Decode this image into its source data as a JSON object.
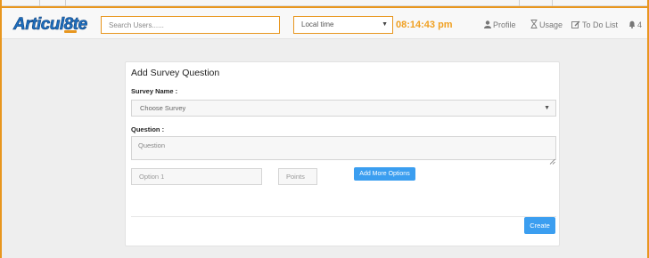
{
  "brand": {
    "logo_text": "Articul8te",
    "accent": "#e8961e",
    "logo_color": "#1d6fc0"
  },
  "search": {
    "placeholder": "Search Users......",
    "value": ""
  },
  "timezone_select": {
    "selected": "Local time",
    "icon": "caret-down-icon"
  },
  "clock": {
    "time": "08:14:43 pm",
    "color": "#f0a021"
  },
  "nav": {
    "profile": {
      "label": "Profile",
      "icon": "user-icon"
    },
    "usage": {
      "label": "Usage",
      "icon": "hourglass-icon"
    },
    "todo": {
      "label": "To Do List",
      "icon": "edit-icon"
    },
    "notifications": {
      "count": "4",
      "icon": "bell-icon"
    }
  },
  "form": {
    "title": "Add Survey Question",
    "survey_label": "Survey Name :",
    "survey_select": {
      "selected": "Choose Survey"
    },
    "question_label": "Question :",
    "question_placeholder": "Question",
    "option_placeholder": "Option 1",
    "points_placeholder": "Points",
    "add_options_label": "Add More Options",
    "create_label": "Create",
    "button_color": "#3b9ef0"
  }
}
